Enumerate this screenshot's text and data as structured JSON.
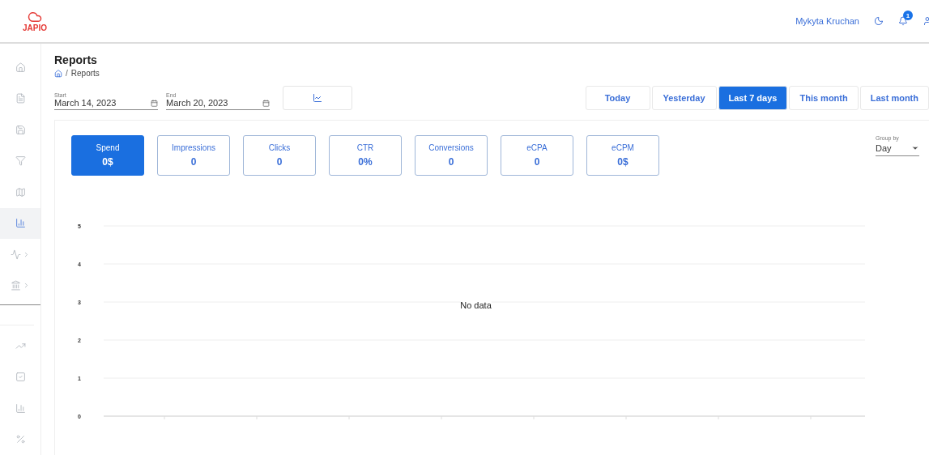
{
  "header": {
    "logo": "JAPIO",
    "user_name": "Mykyta Kruchan",
    "notification_count": "1"
  },
  "sidebar": {
    "items": [
      {
        "selected": false,
        "expandable": false
      },
      {
        "selected": false,
        "expandable": false
      },
      {
        "selected": false,
        "expandable": false
      },
      {
        "selected": false,
        "expandable": false
      },
      {
        "selected": false,
        "expandable": false
      },
      {
        "selected": true,
        "expandable": false
      },
      {
        "selected": false,
        "expandable": true
      },
      {
        "selected": false,
        "expandable": true
      }
    ],
    "bottom_items": [
      {
        "selected": false,
        "expandable": false
      },
      {
        "selected": false,
        "expandable": false
      },
      {
        "selected": false,
        "expandable": false
      },
      {
        "selected": false,
        "expandable": false
      }
    ]
  },
  "page": {
    "title": "Reports",
    "separator": "/",
    "breadcrumb": "Reports"
  },
  "filters": {
    "start": {
      "label": "Start",
      "value": "March 14, 2023"
    },
    "end": {
      "label": "End",
      "value": "March 20, 2023"
    },
    "ranges": [
      {
        "label": "Today",
        "selected": false
      },
      {
        "label": "Yesterday",
        "selected": false
      },
      {
        "label": "Last 7 days",
        "selected": true
      },
      {
        "label": "This month",
        "selected": false
      },
      {
        "label": "Last month",
        "selected": false
      }
    ]
  },
  "metrics": [
    {
      "label": "Spend",
      "value": "0$",
      "selected": true
    },
    {
      "label": "Impressions",
      "value": "0",
      "selected": false
    },
    {
      "label": "Clicks",
      "value": "0",
      "selected": false
    },
    {
      "label": "CTR",
      "value": "0%",
      "selected": false
    },
    {
      "label": "Conversions",
      "value": "0",
      "selected": false
    },
    {
      "label": "eCPA",
      "value": "0",
      "selected": false
    },
    {
      "label": "eCPM",
      "value": "0$",
      "selected": false
    }
  ],
  "group_by": {
    "label": "Group by",
    "value": "Day"
  },
  "chart": {
    "message": "No data",
    "y_ticks": [
      "5",
      "4",
      "3",
      "2",
      "1",
      "0"
    ]
  }
}
